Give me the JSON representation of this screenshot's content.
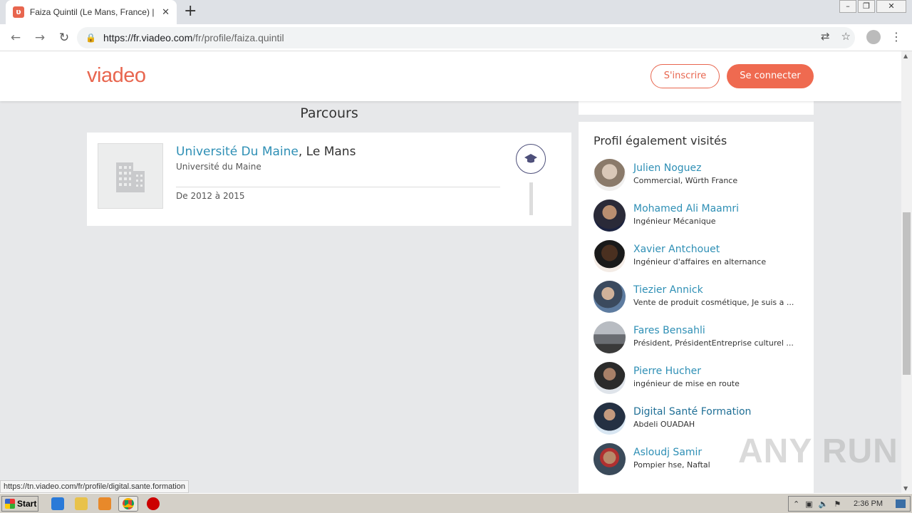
{
  "browser": {
    "tab_title": "Faiza Quintil (Le Mans, France) | Viadeo",
    "tab_close": "✕",
    "new_tab": "+",
    "url_host": "https://fr.viadeo.com",
    "url_path": "/fr/profile/faiza.quintil",
    "status_url": "https://tn.viadeo.com/fr/profile/digital.sante.formation"
  },
  "header": {
    "logo": "viadeo",
    "signup_label": "S'inscrire",
    "login_label": "Se connecter"
  },
  "parcours": {
    "title": "Parcours",
    "school_link": "Université Du Maine",
    "school_city": ", Le Mans",
    "school_sub": "Université du Maine",
    "dates": "De 2012 à 2015"
  },
  "sidebar": {
    "title": "Profil également visités",
    "people": [
      {
        "name": "Julien Noguez",
        "role": "Commercial, Würth France"
      },
      {
        "name": "Mohamed Ali Maamri",
        "role": "Ingénieur Mécanique"
      },
      {
        "name": "Xavier Antchouet",
        "role": "Ingénieur d'affaires en alternance"
      },
      {
        "name": "Tiezier Annick",
        "role": "Vente de produit cosmétique, Je suis a ..."
      },
      {
        "name": "Fares Bensahli",
        "role": "Président, PrésidentEntreprise culturel ..."
      },
      {
        "name": "Pierre Hucher",
        "role": "ingénieur de mise en route"
      },
      {
        "name": "Digital Santé Formation",
        "role": "Abdeli OUADAH"
      },
      {
        "name": "Asloudj Samir",
        "role": "Pompier hse, Naftal"
      }
    ]
  },
  "watermark": "ANY RUN",
  "taskbar": {
    "start_label": "Start",
    "clock": "2:36 PM"
  },
  "colors": {
    "accent": "#e8664f",
    "link": "#2e8fb5"
  }
}
